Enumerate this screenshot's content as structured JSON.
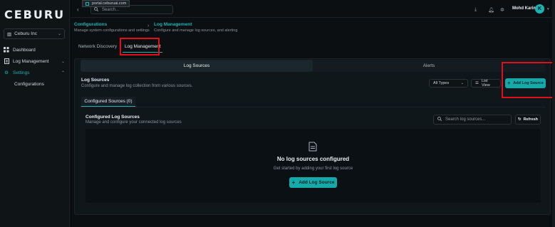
{
  "browser": {
    "url": "portal.ceburuai.com"
  },
  "sidebar": {
    "logo": "CEBURU",
    "org": "Ceburu Inc",
    "items": [
      {
        "label": "Dashboard"
      },
      {
        "label": "Log Management"
      },
      {
        "label": "Settings"
      }
    ],
    "sub_items": [
      {
        "label": "Configurations"
      }
    ]
  },
  "topbar": {
    "back": "‹",
    "search_placeholder": "Search...",
    "user_name": "Mohd Karim",
    "avatar_letter": "K"
  },
  "breadcrumb": [
    {
      "title": "Configurations",
      "subtitle": "Manage system configurations and settings"
    },
    {
      "title": "Log Management",
      "subtitle": "Configure and manage log sources, and alerting"
    }
  ],
  "tabs": [
    {
      "label": "Network Discovery"
    },
    {
      "label": "Log Management"
    }
  ],
  "segments": [
    {
      "label": "Log Sources"
    },
    {
      "label": "Alerts"
    }
  ],
  "log_sources": {
    "title": "Log Sources",
    "subtitle": "Configure and manage log collection from various sources.",
    "type_filter": "All Types",
    "view_button": "List View",
    "add_button": "Add Log Source"
  },
  "configured": {
    "tab": "Configured Sources (0)",
    "title": "Configured Log Sources",
    "subtitle": "Manage and configure your connected log sources",
    "search_placeholder": "Search log sources...",
    "refresh": "Refresh"
  },
  "empty_state": {
    "title": "No log sources configured",
    "subtitle": "Get started by adding your first log source",
    "button": "Add Log Source"
  },
  "colors": {
    "accent": "#19b3b3",
    "highlight": "#e0101a"
  }
}
